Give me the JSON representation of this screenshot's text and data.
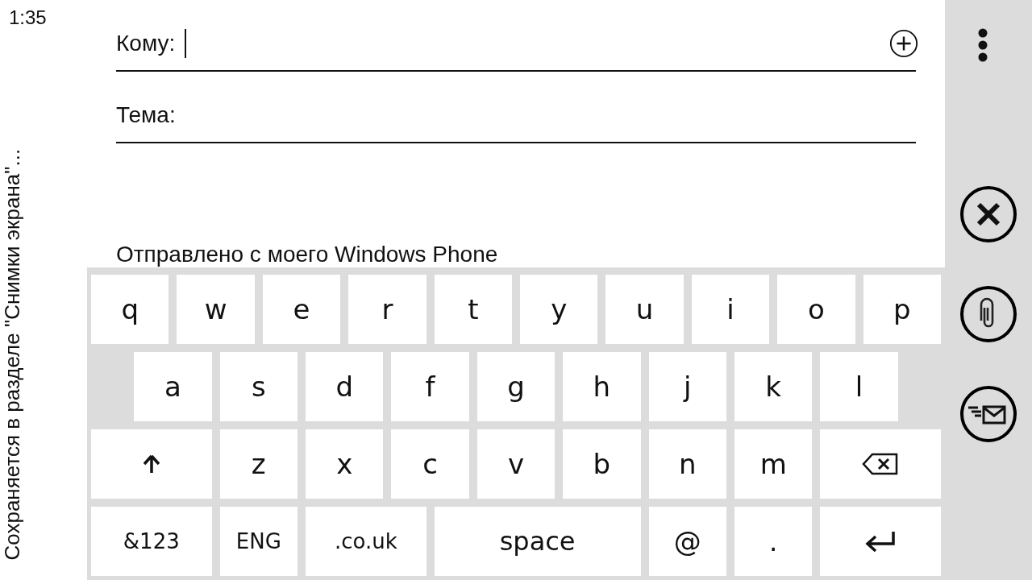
{
  "status_bar": {
    "time": "1:35"
  },
  "toast": {
    "text": "Сохраняется в разделе \"Снимки экрана\"..."
  },
  "compose": {
    "to": {
      "label": "Кому:",
      "focused": true
    },
    "subject": {
      "label": "Тема:"
    },
    "signature": "Отправлено с моего Windows Phone"
  },
  "keyboard": {
    "lines": [
      [
        {
          "label": "q",
          "kind": "letter"
        },
        {
          "label": "w",
          "kind": "letter"
        },
        {
          "label": "e",
          "kind": "letter"
        },
        {
          "label": "r",
          "kind": "letter"
        },
        {
          "label": "t",
          "kind": "letter"
        },
        {
          "label": "y",
          "kind": "letter"
        },
        {
          "label": "u",
          "kind": "letter"
        },
        {
          "label": "i",
          "kind": "letter"
        },
        {
          "label": "o",
          "kind": "letter"
        },
        {
          "label": "p",
          "kind": "letter"
        }
      ],
      [
        {
          "label": "a",
          "kind": "letter"
        },
        {
          "label": "s",
          "kind": "letter"
        },
        {
          "label": "d",
          "kind": "letter"
        },
        {
          "label": "f",
          "kind": "letter"
        },
        {
          "label": "g",
          "kind": "letter"
        },
        {
          "label": "h",
          "kind": "letter"
        },
        {
          "label": "j",
          "kind": "letter"
        },
        {
          "label": "k",
          "kind": "letter"
        },
        {
          "label": "l",
          "kind": "letter"
        }
      ],
      [
        {
          "kind": "shift"
        },
        {
          "label": "z",
          "kind": "letter"
        },
        {
          "label": "x",
          "kind": "letter"
        },
        {
          "label": "c",
          "kind": "letter"
        },
        {
          "label": "v",
          "kind": "letter"
        },
        {
          "label": "b",
          "kind": "letter"
        },
        {
          "label": "n",
          "kind": "letter"
        },
        {
          "label": "m",
          "kind": "letter"
        },
        {
          "kind": "backspace"
        }
      ],
      [
        {
          "label": "&123",
          "kind": "mode"
        },
        {
          "label": "ENG",
          "kind": "lang"
        },
        {
          "label": ".co.uk",
          "kind": "mode"
        },
        {
          "label": "space",
          "kind": "space"
        },
        {
          "label": "@",
          "kind": "symbol"
        },
        {
          "label": ".",
          "kind": "symbol"
        },
        {
          "kind": "enter"
        }
      ]
    ]
  },
  "app_bar": {
    "buttons": [
      {
        "kind": "close"
      },
      {
        "kind": "attach"
      },
      {
        "kind": "send"
      }
    ]
  }
}
